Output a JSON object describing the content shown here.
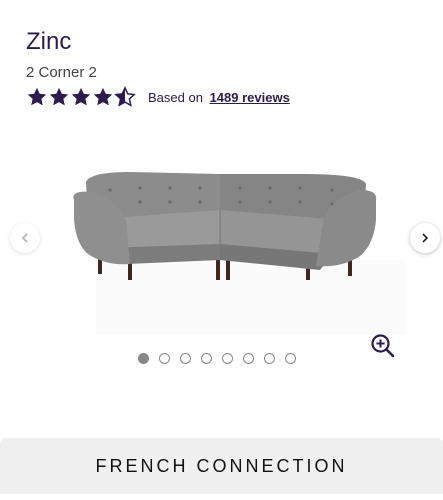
{
  "product": {
    "title": "Zinc",
    "subtitle": "2 Corner 2",
    "rating": {
      "value": 4.5,
      "max": 5,
      "based_on_label": "Based on",
      "reviews_link": "1489 reviews"
    }
  },
  "gallery": {
    "image_count": 8,
    "active_index": 0,
    "icons": {
      "prev": "chevron-left-icon",
      "next": "chevron-right-icon",
      "zoom": "zoom-in-icon"
    }
  },
  "brand": {
    "name": "FRENCH CONNECTION"
  },
  "colors": {
    "accent": "#2d1b4e",
    "dot_inactive_border": "#888888",
    "brand_bar": "#f0f0f0"
  }
}
